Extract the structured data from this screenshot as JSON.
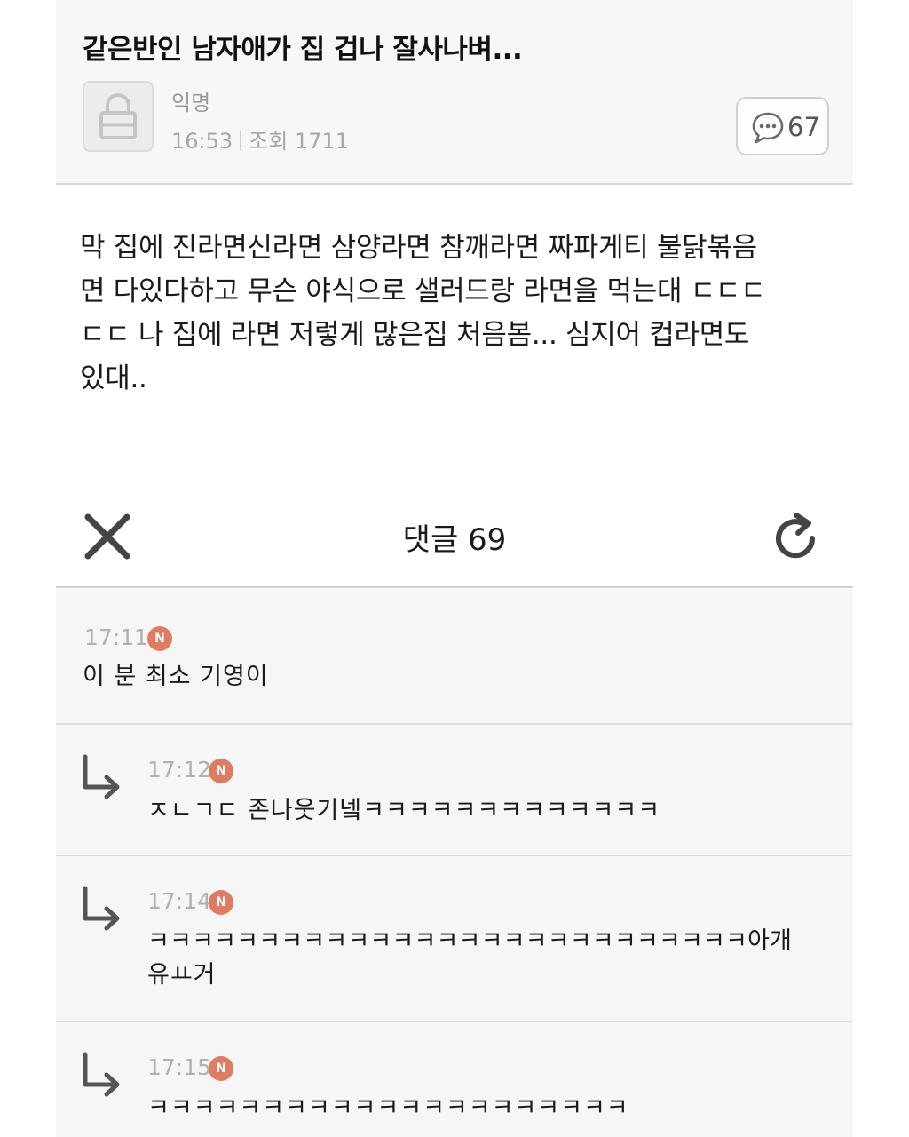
{
  "post": {
    "title": "같은반인 남자애가 집 겁나 잘사나벼...",
    "author": "익명",
    "time": "16:53",
    "views": "조회 1711",
    "comment_count": "67",
    "body": [
      "막 집에 진라면신라면 삼양라면 참깨라면 짜파게티 불닭볶음",
      "면 다있다하고 무슨 야식으로 샐러드랑 라면을 먹는대 ㄷㄷㄷ",
      "ㄷㄷ 나 집에 라면 저렇게 많은집 처음봄... 심지어 컵라면도",
      "있대.."
    ]
  },
  "comments_bar": {
    "title": "댓글 69"
  },
  "comments": [
    {
      "time": "17:11",
      "badge": "N",
      "text": [
        "이 분 최소 기영이"
      ]
    },
    {
      "time": "17:12",
      "badge": "N",
      "text": [
        "ㅈㄴㄱㄷ 존나웃기넼ㅋㅋㅋㅋㅋㅋㅋㅋㅋㅋㅋㅋㅋ"
      ]
    },
    {
      "time": "17:14",
      "badge": "N",
      "text": [
        "ㅋㅋㅋㅋㅋㅋㅋㅋㅋㅋㅋㅋㅋㅋㅋㅋㅋㅋㅋㅋㅋㅋㅋㅋㅋㅋㅋ아개",
        "유ㅛ거"
      ]
    },
    {
      "time": "17:15",
      "badge": "N",
      "text": [
        "ㅋㅋㅋㅋㅋㅋㅋㅋㅋㅋㅋㅋㅋㅋㅋㅋㅋㅋㅋㅋㅋ"
      ]
    }
  ],
  "icons": {
    "avatar": "lock-icon",
    "comment_count": "speech-bubble-icon",
    "close": "close-icon",
    "refresh": "refresh-icon",
    "reply": "reply-arrow-icon"
  },
  "colors": {
    "badge": "#e07b62",
    "header_bg": "#f7f7f7",
    "comment_bg": "#f6f6f6"
  }
}
